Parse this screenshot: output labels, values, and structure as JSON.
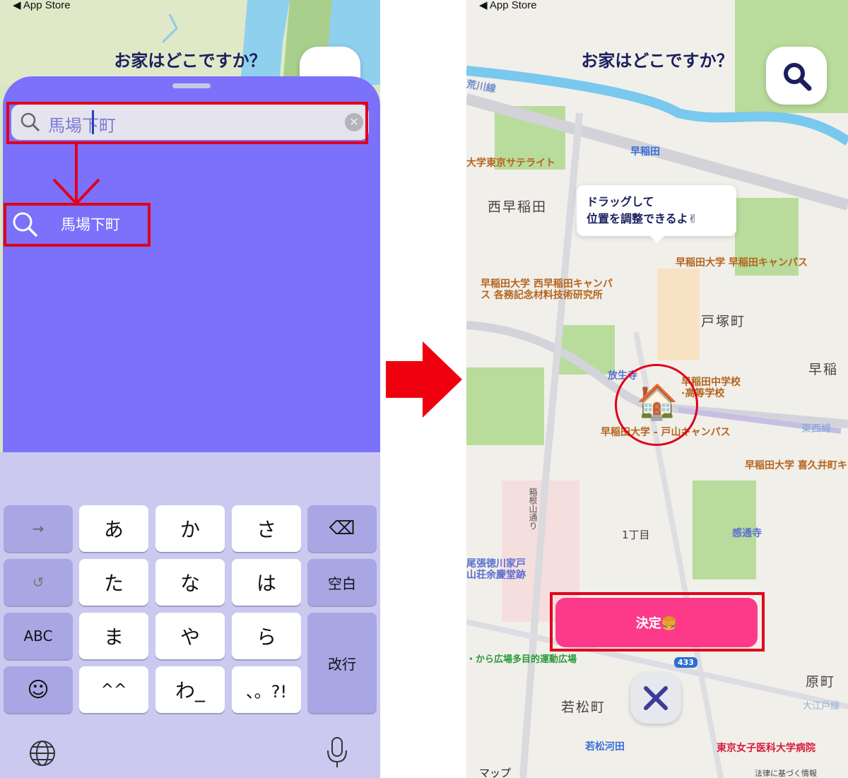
{
  "status_back": "◀ App Store",
  "left": {
    "title": "お家はどこですか？",
    "search": {
      "value": "馬場下町",
      "clear_icon": "clear-icon"
    },
    "result": {
      "label": "馬場下町"
    },
    "keyboard": {
      "rows": [
        [
          "→",
          "あ",
          "か",
          "さ",
          "⌫"
        ],
        [
          "↺",
          "た",
          "な",
          "は",
          "空白"
        ],
        [
          "ABC",
          "ま",
          "や",
          "ら",
          "改行"
        ],
        [
          "☺",
          "^^",
          "わ_",
          "、。?!"
        ]
      ],
      "globe_icon": "globe-icon",
      "mic_icon": "microphone-icon"
    }
  },
  "right": {
    "title": "お家はどこですか？",
    "tooltip": [
      "ドラッグして",
      "位置を調整できるよ✌"
    ],
    "decide_label": "決定🍔",
    "map_labels": {
      "arakawa": "荒川線",
      "waseda_st": "早稲田",
      "satellite": "大学東京サテライト",
      "nishi_waseda": "西早稲田",
      "waseda_campus": "早稲田大学 早稲田キャンパス",
      "nishi_campus_1": "早稲田大学 西早稲田キャンパ",
      "nishi_campus_2": "ス 各務記念材料技術研究所",
      "totsuka": "戸塚町",
      "hoshoji": "放生寺",
      "jhs_1": "早稲田中学校",
      "jhs_2": "·高等学校",
      "toyama": "早稲田大学 - 戸山キャンパス",
      "waseda_right": "早稲",
      "tozai": "東西線",
      "kikui": "早稲田大学 喜久井町キ",
      "hakone": "箱根山通り",
      "itchome": "1丁目",
      "kantsuji": "感通寺",
      "owari_1": "尾張徳川家戸",
      "owari_2": "山荘余慶堂跡",
      "hiroba": "・から広場多目的運動広場",
      "route": "433",
      "haramachi": "原町",
      "oedo": "大江戸線",
      "wakamatsu": "若松町",
      "wakamatsu_kawada": "若松河田",
      "twmu": "東京女子医科大学病院",
      "maps": "マップ",
      "legal": "法律に基づく情報"
    }
  },
  "colors": {
    "sheet": "#7b71fb",
    "keyboard": "#cbc9f0",
    "decide": "#fd3a8a",
    "highlight": "#e0001b",
    "title": "#1b1f5e"
  }
}
